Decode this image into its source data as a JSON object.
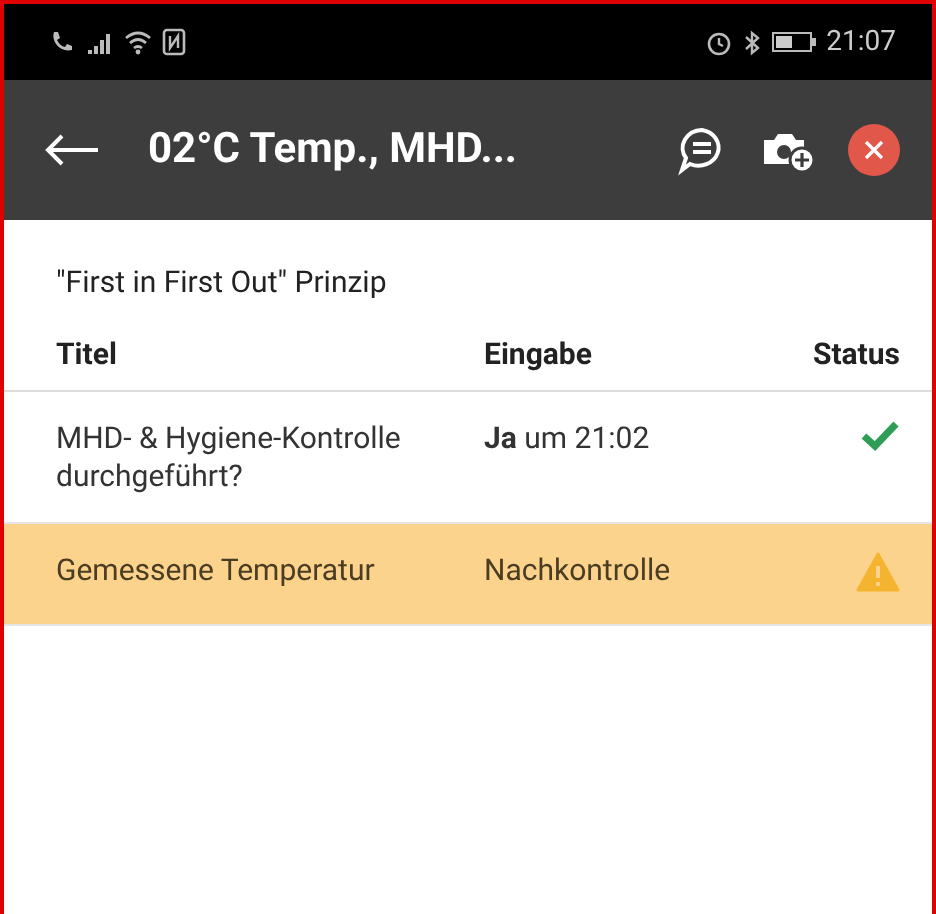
{
  "status_bar": {
    "time": "21:07"
  },
  "app_bar": {
    "title": "02°C Temp., MHD..."
  },
  "subtitle": "\"First in First Out\" Prinzip",
  "table": {
    "columns": [
      "Titel",
      "Eingabe",
      "Status"
    ],
    "rows": [
      {
        "title": "MHD- & Hygiene-Kontrolle durchgeführt?",
        "input": "**Ja** um 21:02",
        "kind": "ok",
        "highlighted": false
      },
      {
        "title": "Gemessene Temperatur",
        "input": "Nachkontrolle",
        "kind": "warning",
        "highlighted": true
      }
    ]
  }
}
